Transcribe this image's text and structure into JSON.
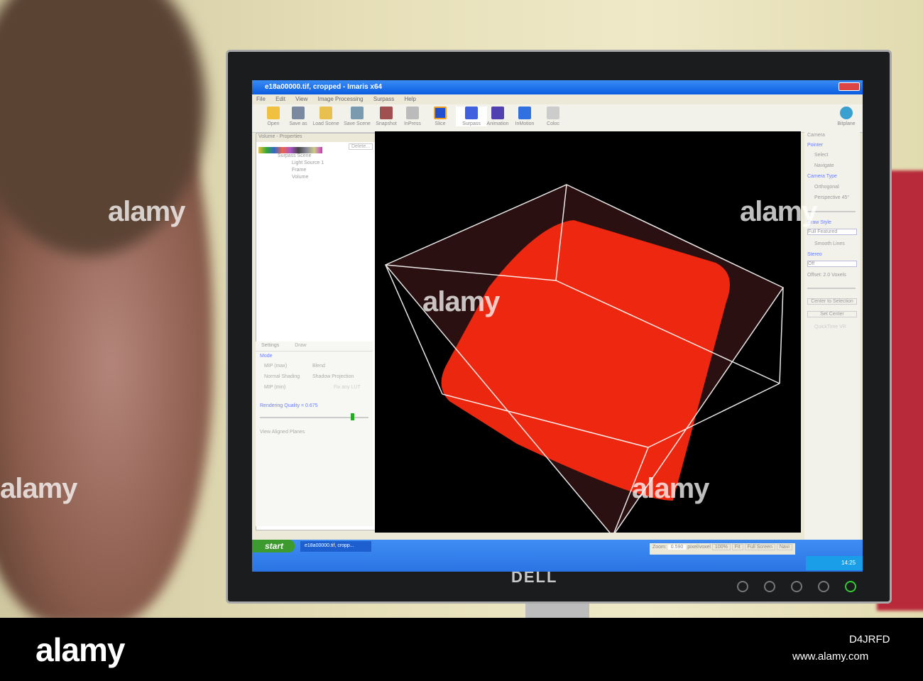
{
  "window": {
    "title": "e18a00000.tif, cropped - Imaris x64"
  },
  "menu": [
    "File",
    "Edit",
    "View",
    "Image Processing",
    "Surpass",
    "Help"
  ],
  "toolbar": [
    "Open",
    "Save as",
    "Load Scene",
    "Save Scene",
    "Snapshot",
    "InPress",
    "Slice",
    "Surpass",
    "Animation",
    "InMotion",
    "Coloc"
  ],
  "toolbar_right": "Bitplane",
  "left_panel": {
    "title": "Volume - Properties",
    "delete": "Delete...",
    "tree": [
      "Surpass Scene",
      "Light Source 1",
      "Frame",
      "Volume"
    ]
  },
  "settings": {
    "tabs": [
      "Settings",
      "Draw"
    ],
    "mode_label": "Mode",
    "modes": [
      "MIP (max)",
      "Blend",
      "Normal Shading",
      "Shadow Projection",
      "MIP (min)",
      "Fix any LUT"
    ],
    "quality": "Rendering Quality = 0.675",
    "aligned": "View Aligned Planes"
  },
  "camera": {
    "title": "Camera",
    "pointer": "Pointer",
    "select": "Select",
    "navigate": "Navigate",
    "type": "Camera Type",
    "ortho": "Orthogonal",
    "persp": "Perspective 45°",
    "draw_style": "Draw Style",
    "draw_value": "Full Featured",
    "smooth": "Smooth Lines",
    "stereo": "Stereo",
    "stereo_value": "Off",
    "offset": "Offset: 2.0 Voxels",
    "center_sel": "Center to Selection",
    "set_center": "Set Center",
    "quicktime": "QuickTime VR"
  },
  "status": {
    "zoom_label": "Zoom:",
    "zoom_value": "0.590",
    "unit": "pixel/voxel",
    "b100": "100%",
    "fit": "Fit",
    "full": "Full Screen",
    "navi": "Navi"
  },
  "taskbar": {
    "start": "start",
    "task": "e18a00000.tif, cropp...",
    "clock": "14:25"
  },
  "monitor": {
    "brand": "DELL"
  },
  "watermark": {
    "logo": "alamy",
    "id": "D4JRFD",
    "url": "www.alamy.com"
  },
  "colors": {
    "volume": "#ff2a10",
    "titlebar": "#0a5ce0"
  }
}
